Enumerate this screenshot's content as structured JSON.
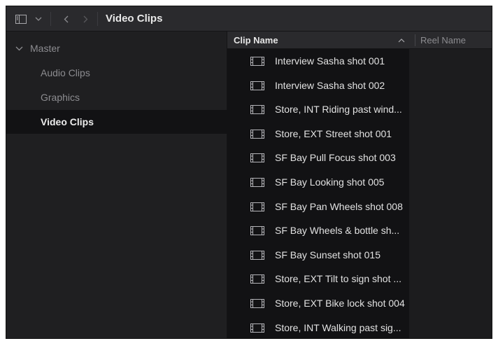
{
  "toolbar": {
    "title": "Video Clips"
  },
  "bins": [
    {
      "label": "Master",
      "expanded": true,
      "selected": false
    },
    {
      "label": "Audio Clips",
      "selected": false
    },
    {
      "label": "Graphics",
      "selected": false
    },
    {
      "label": "Video Clips",
      "selected": true
    }
  ],
  "columns": {
    "clip_name": "Clip Name",
    "reel_name": "Reel Name"
  },
  "clips": [
    "Interview Sasha shot 001",
    "Interview Sasha shot 002",
    "Store, INT Riding past wind...",
    "Store, EXT Street shot 001",
    "SF Bay Pull Focus shot 003",
    "SF Bay Looking shot 005",
    "SF Bay Pan Wheels shot 008",
    "SF Bay Wheels & bottle sh...",
    "SF Bay Sunset shot 015",
    "Store, EXT Tilt to sign shot ...",
    "Store, EXT Bike lock shot 004",
    "Store, INT Walking past sig..."
  ],
  "colors": {
    "panel_bg": "#1b1b1d",
    "toolbar_bg": "#2a2a2d",
    "selected_bg": "#121214"
  }
}
